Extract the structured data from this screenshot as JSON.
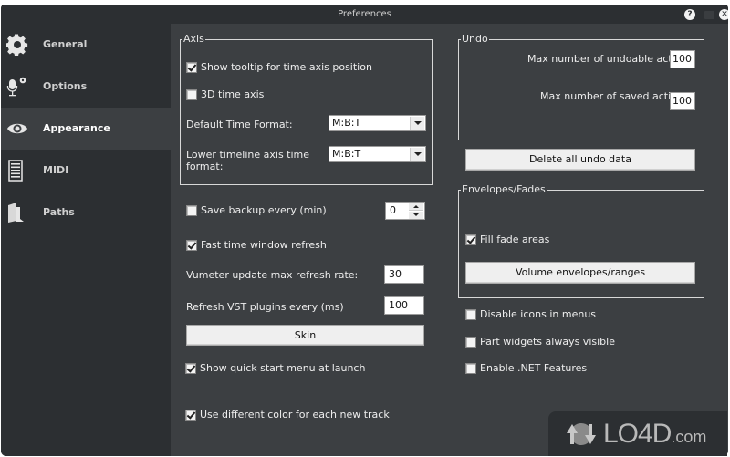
{
  "window": {
    "title": "Preferences",
    "buttons": {
      "help": "?",
      "close": "✕"
    }
  },
  "sidebar": {
    "items": [
      {
        "label": "General",
        "icon": "gear-icon",
        "active": false
      },
      {
        "label": "Options",
        "icon": "microphone-gear-icon",
        "active": false
      },
      {
        "label": "Appearance",
        "icon": "eye-icon",
        "active": true
      },
      {
        "label": "MIDI",
        "icon": "piano-roll-icon",
        "active": false
      },
      {
        "label": "Paths",
        "icon": "book-icon",
        "active": false
      }
    ]
  },
  "axis_group": {
    "title": "Axis",
    "show_tooltip": {
      "label": "Show tooltip for time axis position",
      "checked": true
    },
    "time_axis_3d": {
      "label": "3D time axis",
      "checked": false
    },
    "default_time_format": {
      "label": "Default Time Format:",
      "value": "M:B:T"
    },
    "lower_timeline_format": {
      "label_line1": "Lower timeline axis  time",
      "label_line2": "format:",
      "value": "M:B:T"
    }
  },
  "left_options": {
    "save_backup": {
      "label": "Save backup every (min)",
      "checked": false,
      "value": "0"
    },
    "fast_refresh": {
      "label": "Fast time window refresh",
      "checked": true
    },
    "vumeter_rate": {
      "label": "Vumeter update max refresh rate:",
      "value": "30"
    },
    "vst_refresh": {
      "label": "Refresh VST plugins every (ms)",
      "value": "100"
    },
    "skin_button": "Skin",
    "quick_start": {
      "label": "Show quick start menu at launch",
      "checked": true
    },
    "diff_color": {
      "label": "Use different color for each new track",
      "checked": true
    }
  },
  "undo_group": {
    "title": "Undo",
    "max_undoable": {
      "label": "Max number of undoable actions",
      "value": "100"
    },
    "max_saved": {
      "label": "Max number of saved actions",
      "value": "100"
    },
    "delete_button": "Delete all undo data"
  },
  "envelopes_group": {
    "title": "Envelopes/Fades",
    "fill_fade": {
      "label": "Fill fade areas",
      "checked": true
    },
    "volume_button": "Volume envelopes/ranges"
  },
  "right_options": {
    "disable_icons": {
      "label": "Disable icons in menus",
      "checked": false
    },
    "part_widgets": {
      "label": "Part widgets always visible",
      "checked": false
    },
    "enable_net": {
      "label": "Enable .NET Features",
      "checked": false
    }
  },
  "watermark": {
    "brand": "LO4D",
    "suffix": ".com"
  }
}
